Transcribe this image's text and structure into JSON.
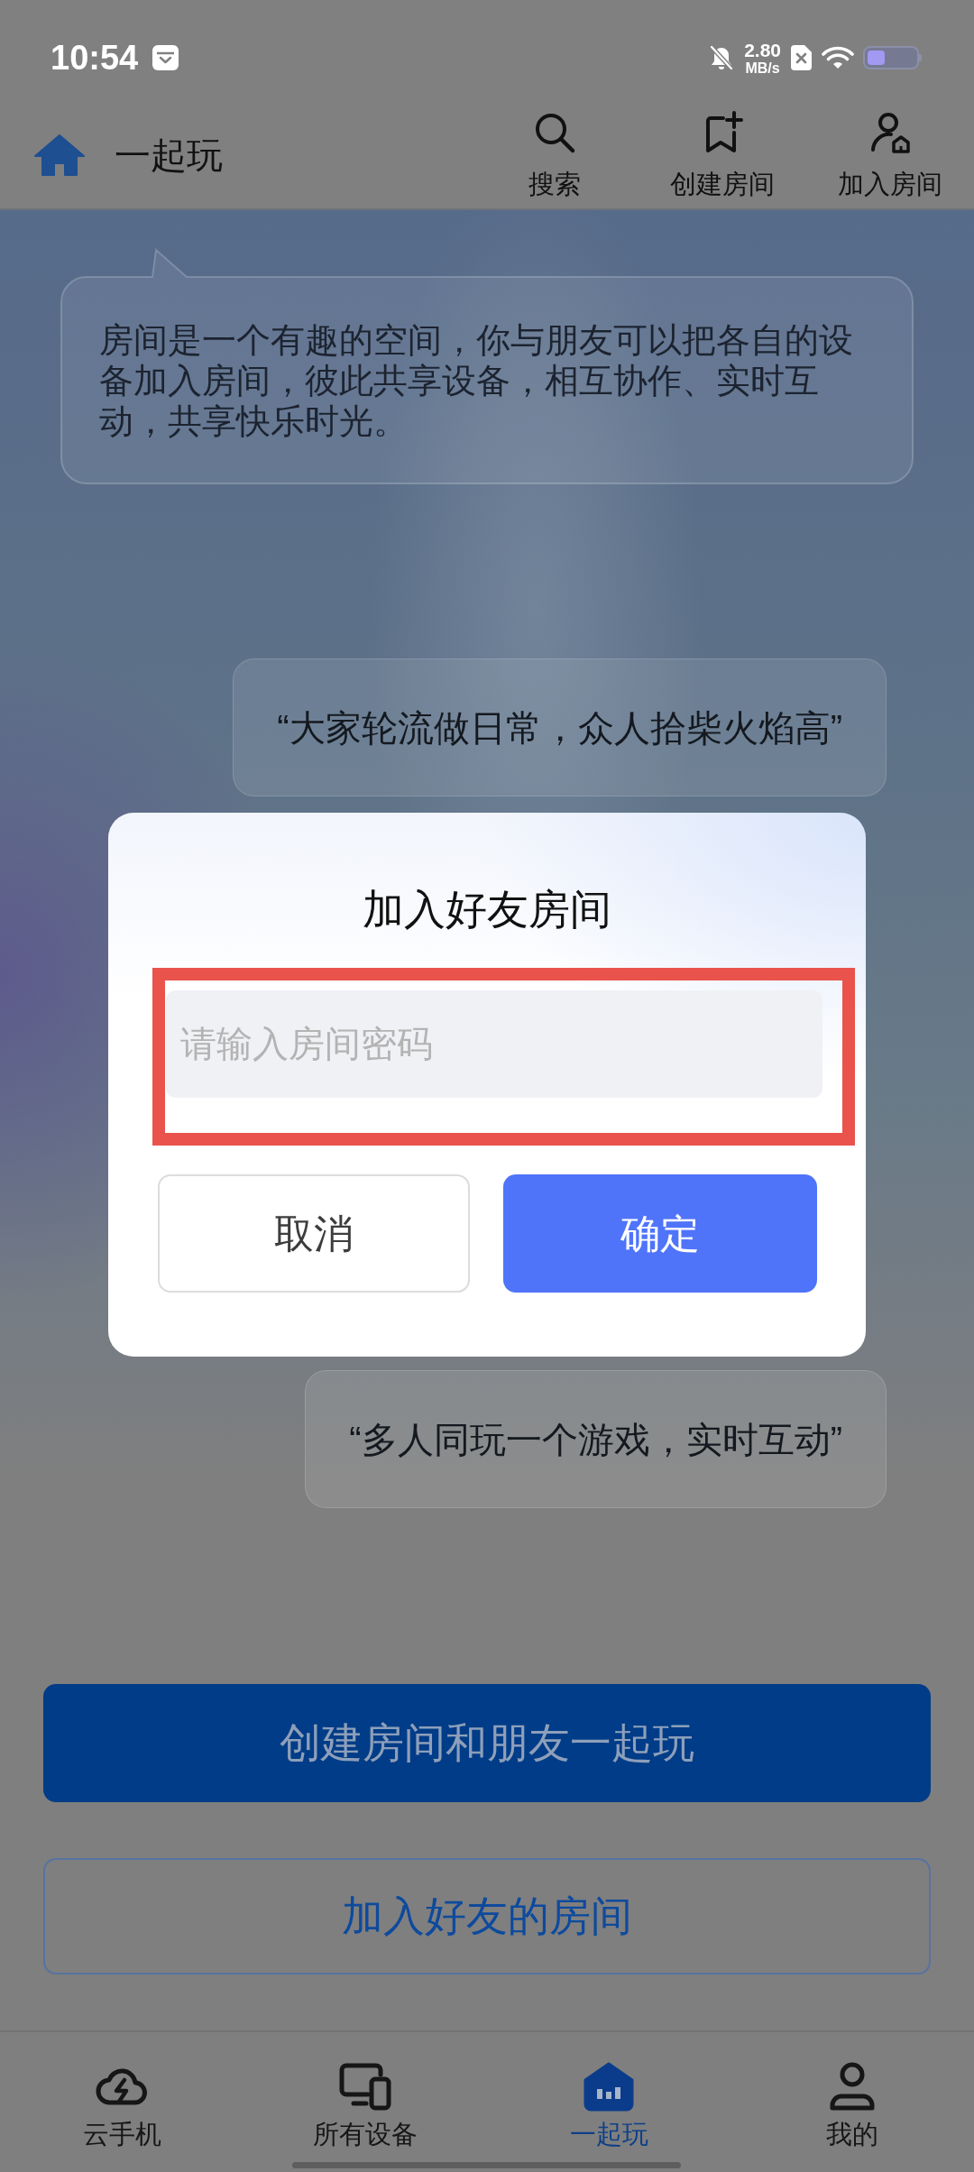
{
  "status_bar": {
    "time": "10:54",
    "net_speed": "2.80",
    "net_speed_unit": "MB/s"
  },
  "header": {
    "title": "一起玩",
    "actions": [
      {
        "label": "搜索"
      },
      {
        "label": "创建房间"
      },
      {
        "label": "加入房间"
      }
    ]
  },
  "intro_bubble": {
    "text": "房间是一个有趣的空间，你与朋友可以把各自的设备加入房间，彼此共享设备，相互协作、实时互动，共享快乐时光。"
  },
  "quotes": [
    {
      "text": "“大家轮流做日常，众人拾柴火焰高”"
    },
    {
      "text": "“多人同玩一个游戏，实时互动”"
    }
  ],
  "dialog": {
    "title": "加入好友房间",
    "input": {
      "placeholder": "请输入房间密码",
      "highlighted": true
    },
    "buttons": [
      {
        "kind": "secondary",
        "label": "取消"
      },
      {
        "kind": "primary",
        "label": "确定"
      }
    ]
  },
  "actions": [
    {
      "kind": "primary",
      "label": "创建房间和朋友一起玩"
    },
    {
      "kind": "outline",
      "label": "加入好友的房间"
    }
  ],
  "bottom_nav": [
    {
      "label": "云手机",
      "selected": false
    },
    {
      "label": "所有设备",
      "selected": false
    },
    {
      "label": "一起玩",
      "selected": true
    },
    {
      "label": "我的",
      "selected": false
    }
  ]
}
